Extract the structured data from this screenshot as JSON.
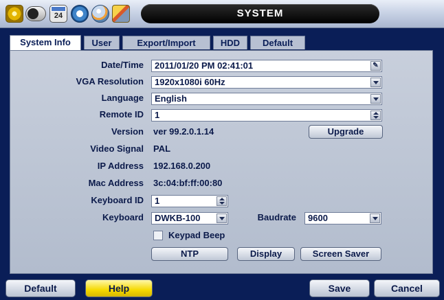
{
  "header": {
    "title": "SYSTEM",
    "icons": [
      "gear-icon",
      "power-toggle-icon",
      "calendar-icon",
      "sync-icon",
      "network-globe-icon",
      "tools-icon"
    ],
    "calendar_day": "24"
  },
  "tabs": [
    {
      "label": "System Info",
      "active": true
    },
    {
      "label": "User",
      "active": false
    },
    {
      "label": "Export/Import",
      "active": false
    },
    {
      "label": "HDD",
      "active": false
    },
    {
      "label": "Default",
      "active": false
    }
  ],
  "fields": {
    "datetime": {
      "label": "Date/Time",
      "value": "2011/01/20 PM 02:41:01"
    },
    "vga_resolution": {
      "label": "VGA Resolution",
      "value": "1920x1080i  60Hz"
    },
    "language": {
      "label": "Language",
      "value": "English"
    },
    "remote_id": {
      "label": "Remote ID",
      "value": "1"
    },
    "version": {
      "label": "Version",
      "value": "ver 99.2.0.1.14"
    },
    "video_signal": {
      "label": "Video Signal",
      "value": "PAL"
    },
    "ip_address": {
      "label": "IP Address",
      "value": "192.168.0.200"
    },
    "mac_address": {
      "label": "Mac Address",
      "value": "3c:04:bf:ff:00:80"
    },
    "keyboard_id": {
      "label": "Keyboard ID",
      "value": "1"
    },
    "keyboard": {
      "label": "Keyboard",
      "value": "DWKB-100"
    },
    "baudrate": {
      "label": "Baudrate",
      "value": "9600"
    },
    "keypad_beep": {
      "label": "Keypad Beep",
      "checked": false
    }
  },
  "buttons": {
    "upgrade": "Upgrade",
    "ntp": "NTP",
    "display": "Display",
    "screen_saver": "Screen Saver"
  },
  "footer": {
    "default": "Default",
    "help": "Help",
    "save": "Save",
    "cancel": "Cancel"
  },
  "colors": {
    "background": "#0a1e57",
    "panel": "#c1c9d8",
    "help_accent": "#f5d900",
    "title_bar": "#000000"
  }
}
